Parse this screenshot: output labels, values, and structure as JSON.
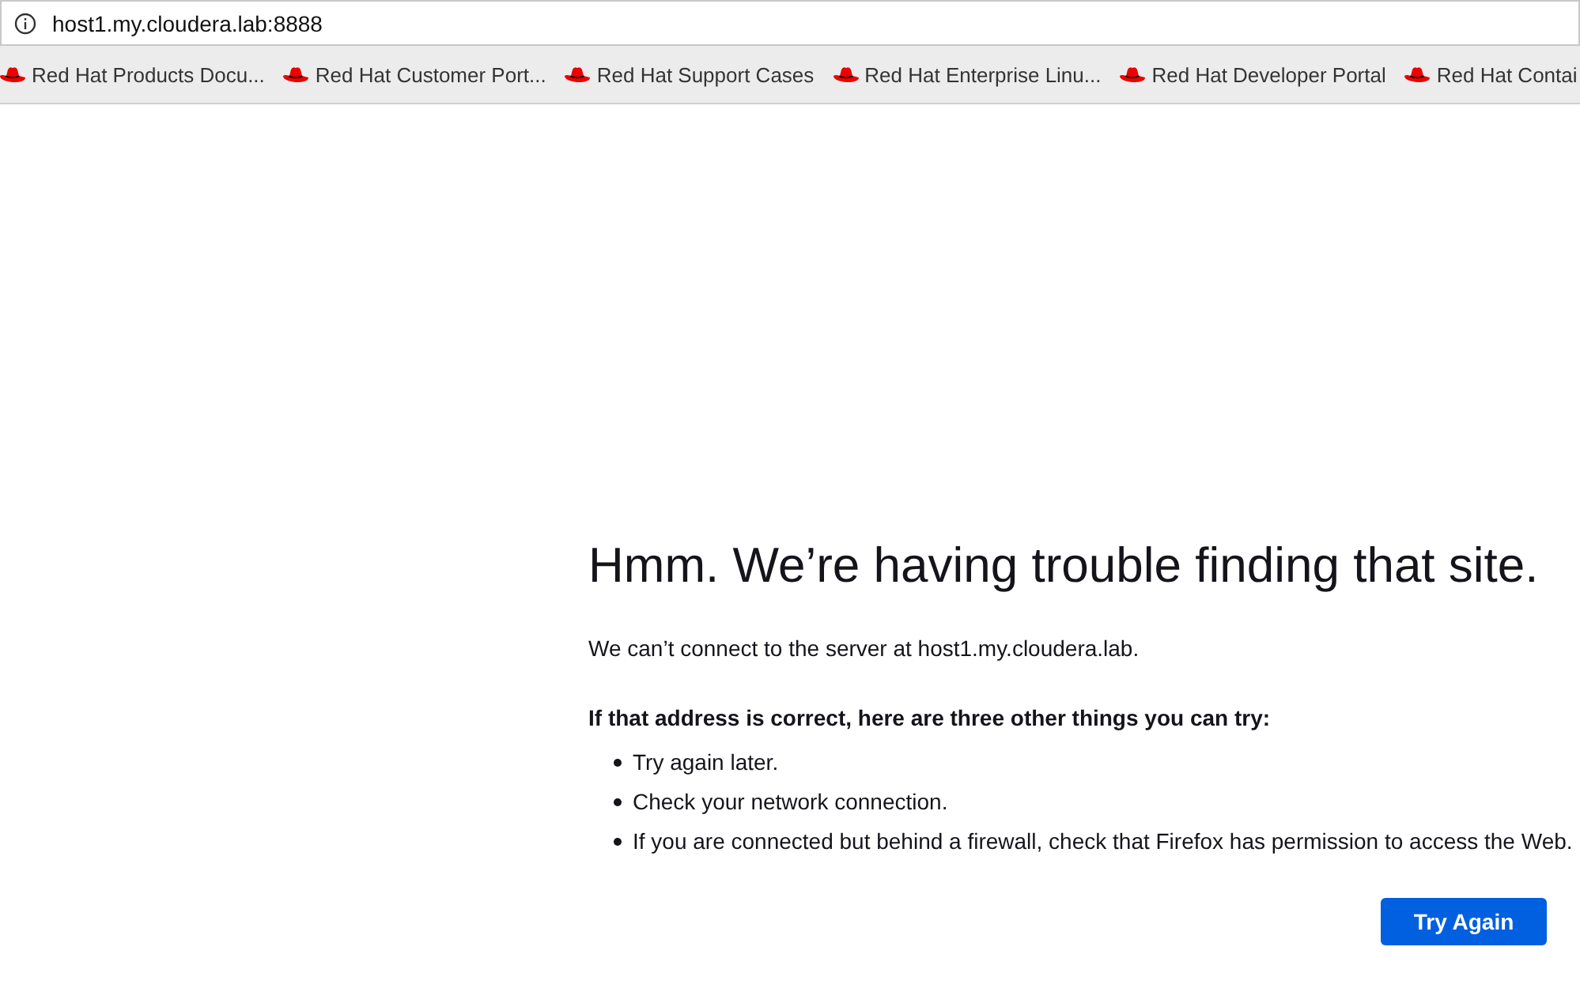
{
  "address_bar": {
    "url": "host1.my.cloudera.lab:8888"
  },
  "bookmarks": [
    "Red Hat Products Docu...",
    "Red Hat Customer Port...",
    "Red Hat Support Cases",
    "Red Hat Enterprise Linu...",
    "Red Hat Developer Portal",
    "Red Hat Contai"
  ],
  "error": {
    "title": "Hmm. We’re having trouble finding that site.",
    "message": "We can’t connect to the server at host1.my.cloudera.lab.",
    "suggestions_heading": "If that address is correct, here are three other things you can try:",
    "suggestions": [
      "Try again later.",
      "Check your network connection.",
      "If you are connected but behind a firewall, check that Firefox has permission to access the Web."
    ],
    "button": "Try Again"
  }
}
